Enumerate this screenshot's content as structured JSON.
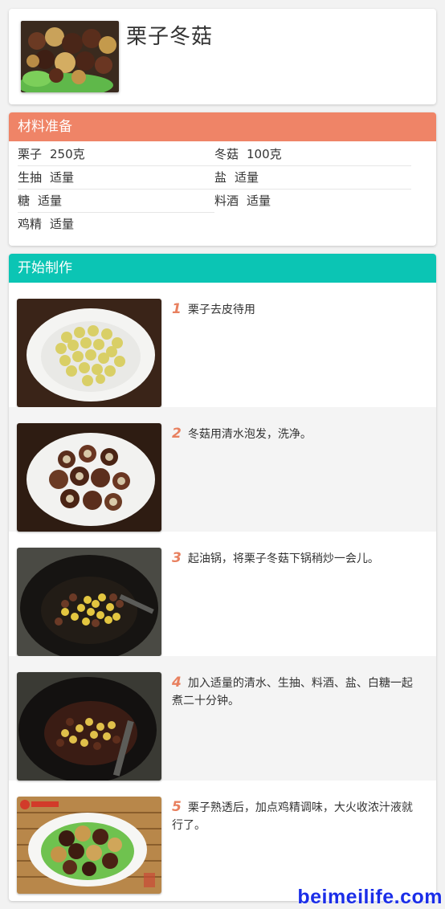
{
  "recipe": {
    "title": "栗子冬菇"
  },
  "ingredients": {
    "heading": "材料准备",
    "color": "#ef8467",
    "rows": [
      [
        {
          "name": "栗子",
          "amount": "250克"
        },
        {
          "name": "冬菇",
          "amount": "100克"
        }
      ],
      [
        {
          "name": "生抽",
          "amount": "适量"
        },
        {
          "name": "盐",
          "amount": "适量"
        }
      ],
      [
        {
          "name": "糖",
          "amount": "适量"
        },
        {
          "name": "料酒",
          "amount": "适量"
        }
      ],
      [
        {
          "name": "鸡精",
          "amount": "适量"
        }
      ]
    ]
  },
  "steps": {
    "heading": "开始制作",
    "color": "#0bc5b4",
    "items": [
      {
        "num": "1",
        "text": "栗子去皮待用"
      },
      {
        "num": "2",
        "text": "冬菇用清水泡发，洗净。"
      },
      {
        "num": "3",
        "text": "起油锅，将栗子冬菇下锅稍炒一会儿。"
      },
      {
        "num": "4",
        "text": "加入适量的清水、生抽、料酒、盐、白糖一起煮二十分钟。"
      },
      {
        "num": "5",
        "text": "栗子熟透后，加点鸡精调味，大火收浓汁液就行了。"
      }
    ]
  },
  "watermark": "beimeilife.com",
  "icons": [
    "recipe-photo",
    "step-photo"
  ]
}
